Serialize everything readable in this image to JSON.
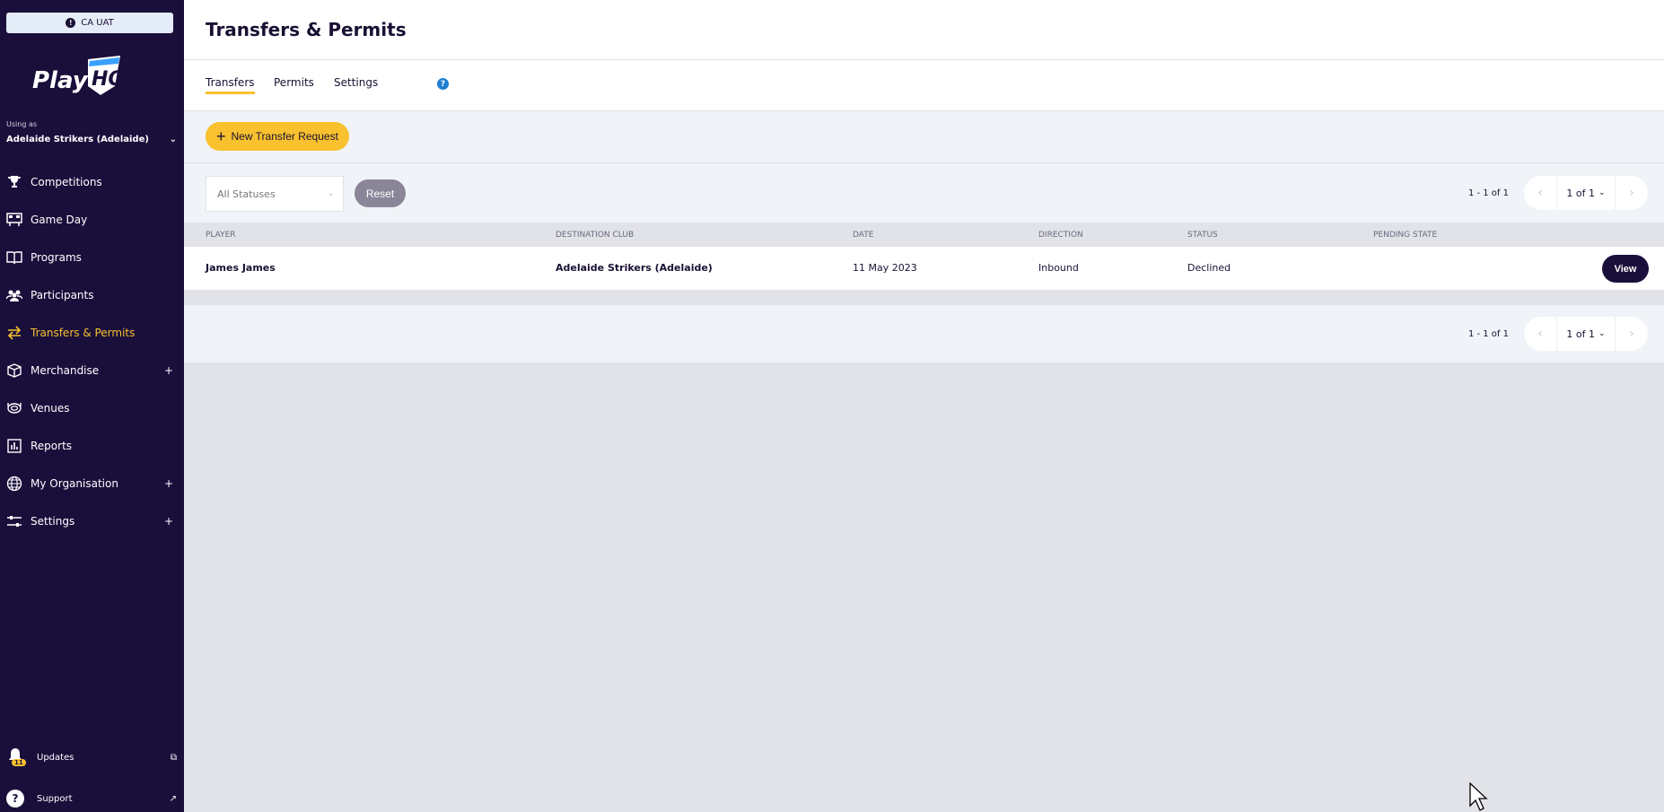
{
  "environment": {
    "label": "CA UAT",
    "dot_glyph": "!"
  },
  "brand": {
    "logo_text_a": "Play",
    "logo_text_b": "HQ"
  },
  "account": {
    "using_as_label": "Using as",
    "org_name": "Adelaide Strikers (Adelaide)"
  },
  "nav": [
    {
      "label": "Competitions",
      "icon": "trophy-icon"
    },
    {
      "label": "Game Day",
      "icon": "scoreboard-icon"
    },
    {
      "label": "Programs",
      "icon": "book-icon"
    },
    {
      "label": "Participants",
      "icon": "people-icon"
    },
    {
      "label": "Transfers & Permits",
      "icon": "arrows-icon",
      "active": true
    },
    {
      "label": "Merchandise",
      "icon": "box-icon",
      "expand": "+"
    },
    {
      "label": "Venues",
      "icon": "stadium-icon"
    },
    {
      "label": "Reports",
      "icon": "report-icon"
    },
    {
      "label": "My Organisation",
      "icon": "globe-icon",
      "expand": "+"
    },
    {
      "label": "Settings",
      "icon": "sliders-icon",
      "expand": "+"
    }
  ],
  "bottom": {
    "updates_label": "Updates",
    "updates_badge": "11",
    "support_label": "Support"
  },
  "page": {
    "title": "Transfers & Permits"
  },
  "tabs": {
    "transfers": "Transfers",
    "permits": "Permits",
    "settings": "Settings",
    "help_glyph": "?"
  },
  "actions": {
    "new_transfer": "New Transfer Request"
  },
  "filters": {
    "status_placeholder": "All Statuses",
    "reset": "Reset"
  },
  "pagination": {
    "count": "1 - 1 of 1",
    "page_select": "1 of 1"
  },
  "table": {
    "columns": {
      "player": "Player",
      "destination_club": "Destination Club",
      "date": "Date",
      "direction": "Direction",
      "status": "Status",
      "pending_state": "Pending State"
    },
    "rows": [
      {
        "player": "James James",
        "destination_club": "Adelaide Strikers (Adelaide)",
        "date": "11 May 2023",
        "direction": "Inbound",
        "status": "Declined",
        "pending_state": "",
        "action": "View"
      }
    ]
  },
  "colors": {
    "sidebar_bg": "#1a0f3b",
    "accent": "#f8c12d",
    "help_blue": "#1e7fd1"
  }
}
